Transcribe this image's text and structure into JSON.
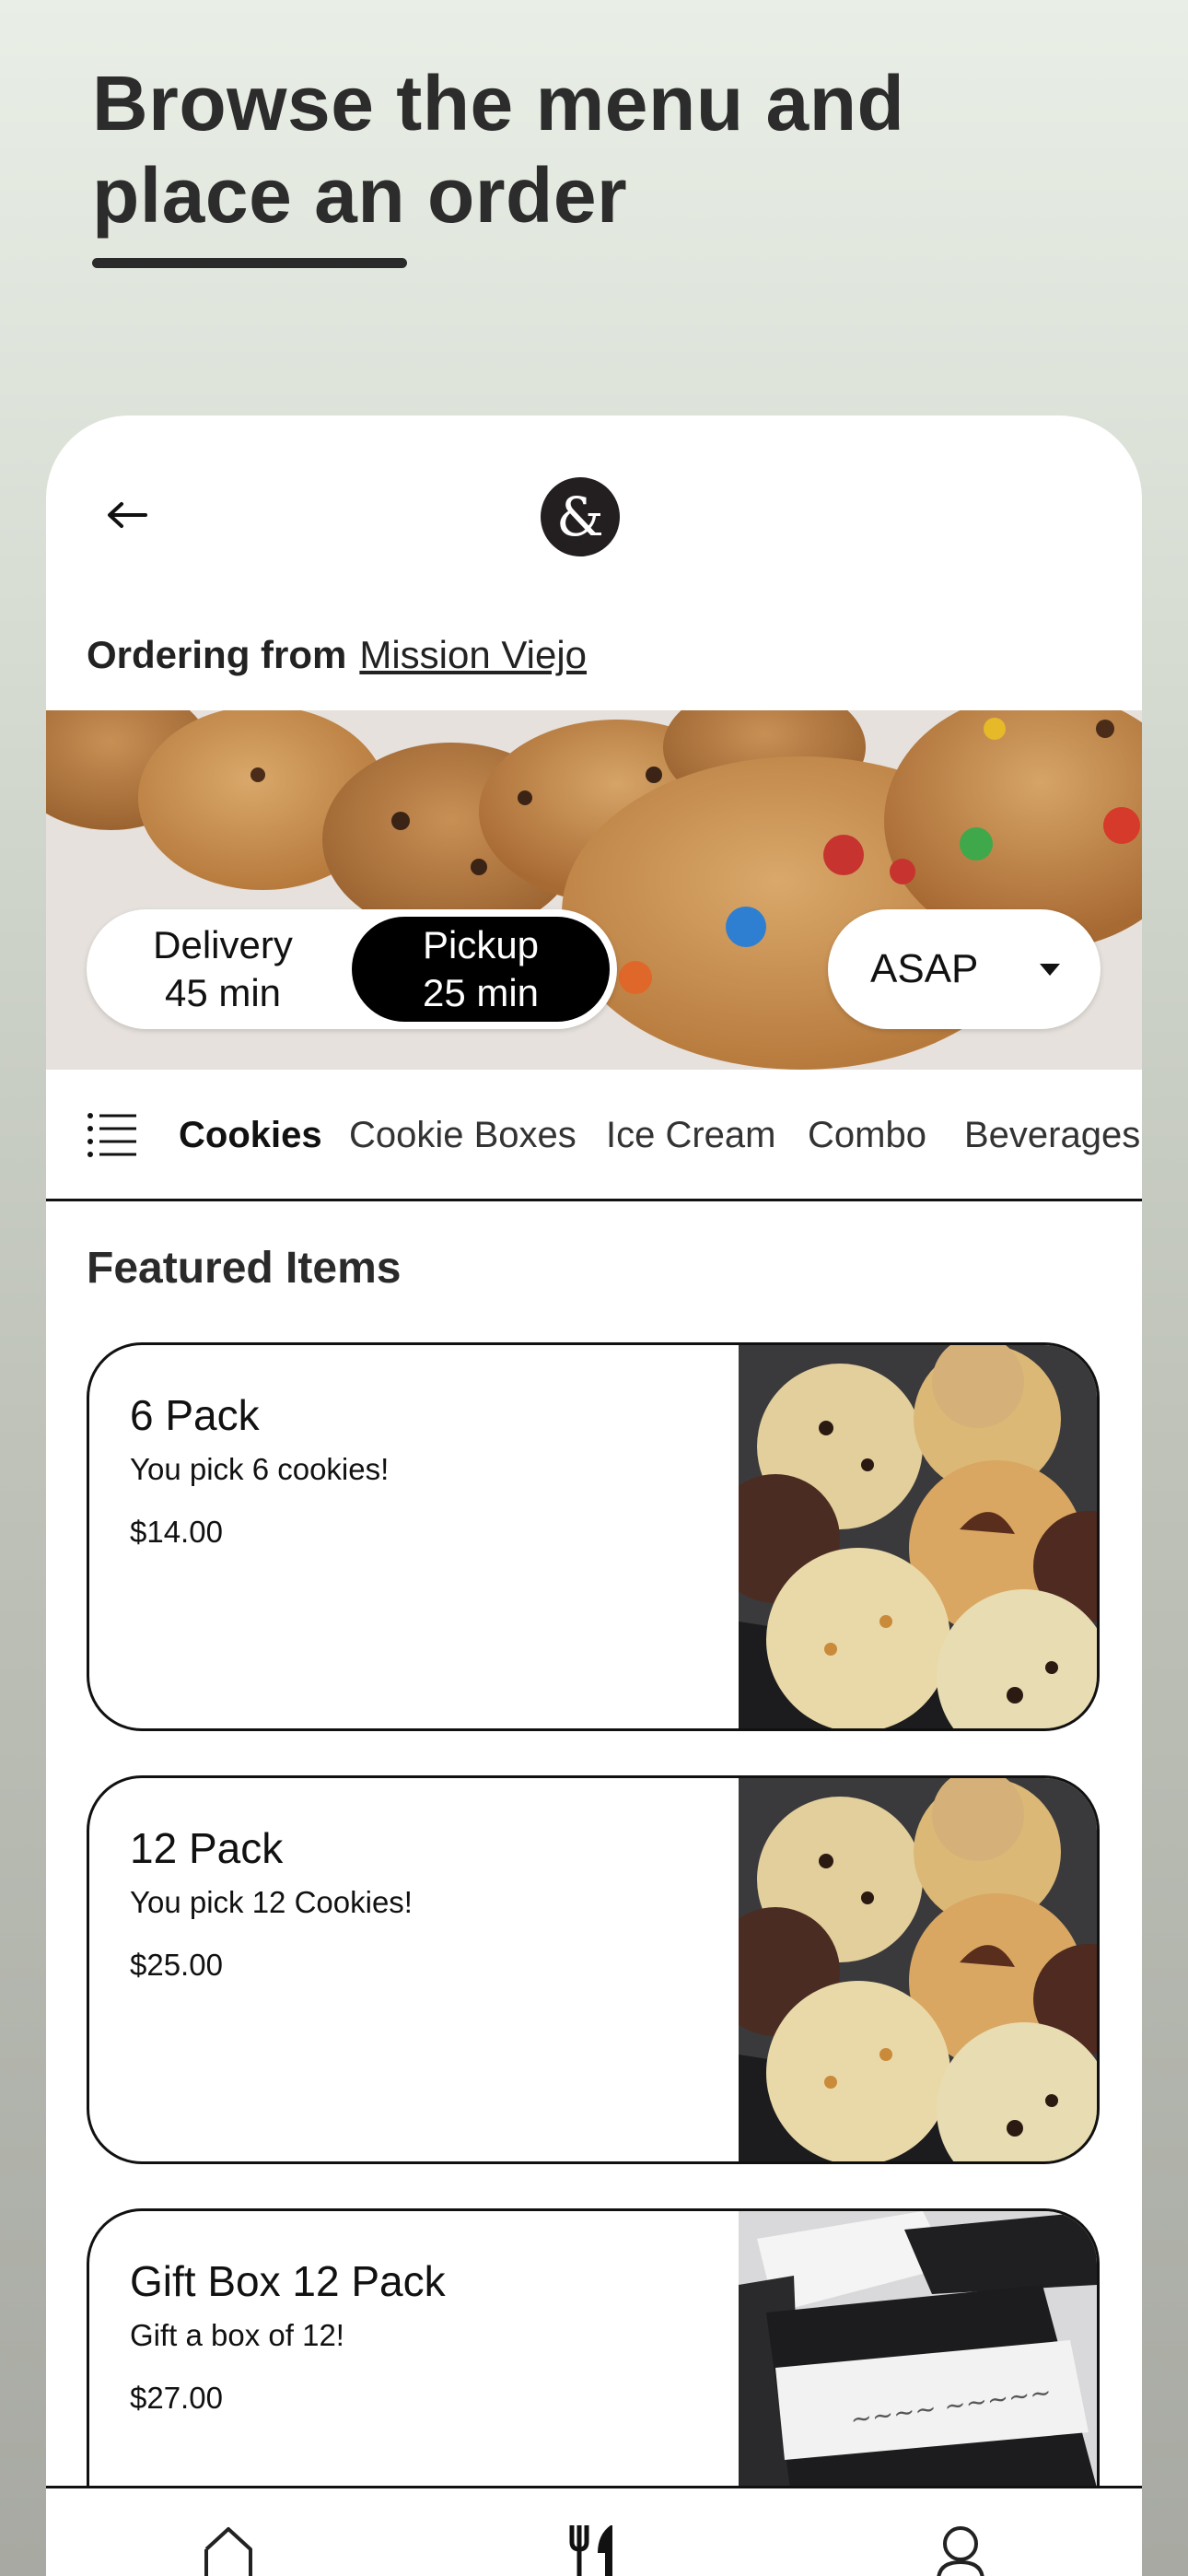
{
  "header": {
    "line1": "Browse the menu and",
    "line2": "place an order"
  },
  "app": {
    "back_icon": "arrow-left-icon",
    "logo_glyph": "&",
    "ordering_label": "Ordering from",
    "location": "Mission Viejo",
    "fulfillment": {
      "delivery_label": "Delivery",
      "delivery_time": "45 min",
      "pickup_label": "Pickup",
      "pickup_time": "25 min",
      "selected": "Pickup"
    },
    "schedule": {
      "value": "ASAP",
      "icon": "caret-down-icon"
    },
    "categories": [
      "Cookies",
      "Cookie Boxes",
      "Ice Cream",
      "Combo",
      "Beverages"
    ],
    "active_category": "Cookies",
    "section_title": "Featured Items",
    "items": [
      {
        "title": "6 Pack",
        "description": "You pick 6 cookies!",
        "price": "$14.00"
      },
      {
        "title": "12 Pack",
        "description": "You pick 12 Cookies!",
        "price": "$25.00"
      },
      {
        "title": "Gift Box 12 Pack",
        "description": "Gift a box of 12!",
        "price": "$27.00"
      }
    ],
    "nav": [
      "home-icon",
      "utensils-icon",
      "user-icon"
    ],
    "colors": {
      "accent": "#000000",
      "background": "#ffffff",
      "logo": "#231f20"
    }
  }
}
